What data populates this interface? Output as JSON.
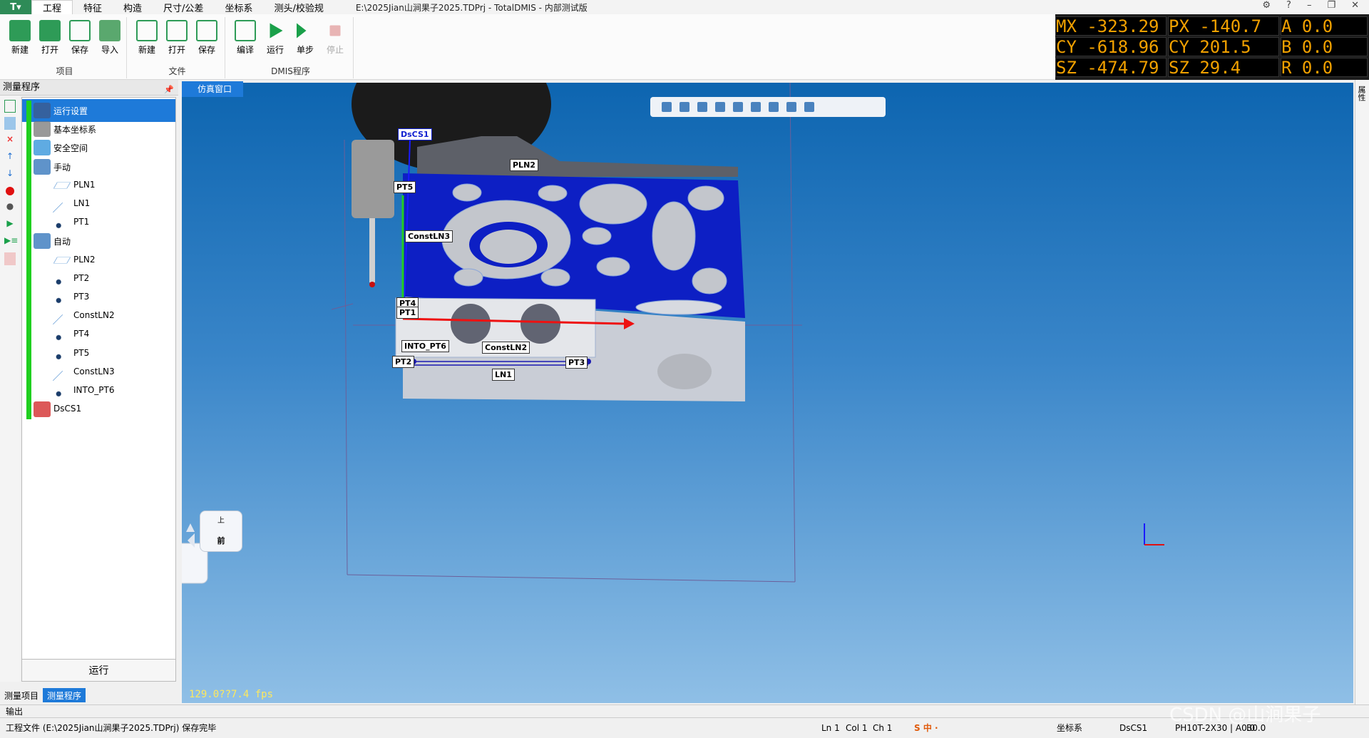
{
  "app": {
    "menu_label": "T▾",
    "window_title": "E:\\2025Jian山涧果子2025.TDPrj - TotalDMIS - 内部测试版"
  },
  "tabs": [
    "工程",
    "特征",
    "构造",
    "尺寸/公差",
    "坐标系",
    "测头/校验规"
  ],
  "ribbon": {
    "groups": [
      {
        "label": "项目",
        "buttons": [
          "新建",
          "打开",
          "保存",
          "导入"
        ]
      },
      {
        "label": "文件",
        "buttons": [
          "新建",
          "打开",
          "保存"
        ]
      },
      {
        "label": "DMIS程序",
        "buttons": [
          "编译",
          "运行",
          "单步",
          "停止"
        ]
      }
    ]
  },
  "readout": {
    "rows": [
      [
        "MX",
        "-323.29",
        "PX",
        "-140.7",
        "A",
        "0.0"
      ],
      [
        "CY",
        "-618.96",
        "CY",
        "201.5",
        "B",
        "0.0"
      ],
      [
        "SZ",
        "-474.79",
        "SZ",
        "29.4",
        "R",
        "0.0"
      ]
    ],
    "color": "#f2a100"
  },
  "right_sidebar": {
    "label": "属性"
  },
  "left_panel": {
    "title": "测量程序",
    "items": [
      {
        "label": "运行设置",
        "icon": "run-settings-icon",
        "level": 0,
        "selected": true
      },
      {
        "label": "基本坐标系",
        "icon": "base-csys-icon",
        "level": 0
      },
      {
        "label": "安全空间",
        "icon": "safe-space-icon",
        "level": 0
      },
      {
        "label": "手动",
        "icon": "folder-tree-icon",
        "level": 0
      },
      {
        "label": "PLN1",
        "icon": "plane-icon",
        "level": 1
      },
      {
        "label": "LN1",
        "icon": "line-icon",
        "level": 1
      },
      {
        "label": "PT1",
        "icon": "point-icon",
        "level": 1
      },
      {
        "label": "自动",
        "icon": "folder-tree-icon",
        "level": 0
      },
      {
        "label": "PLN2",
        "icon": "plane-icon",
        "level": 1
      },
      {
        "label": "PT2",
        "icon": "point-icon",
        "level": 1
      },
      {
        "label": "PT3",
        "icon": "point-icon",
        "level": 1
      },
      {
        "label": "ConstLN2",
        "icon": "line-icon",
        "level": 1
      },
      {
        "label": "PT4",
        "icon": "point-icon",
        "level": 1
      },
      {
        "label": "PT5",
        "icon": "point-icon",
        "level": 1
      },
      {
        "label": "ConstLN3",
        "icon": "line-icon",
        "level": 1
      },
      {
        "label": "INTO_PT6",
        "icon": "point-icon",
        "level": 1
      },
      {
        "label": "DsCS1",
        "icon": "csys-icon",
        "level": 0
      }
    ],
    "run_button": "运行",
    "bottom_tabs": [
      "测量项目",
      "测量程序"
    ]
  },
  "viewport": {
    "tab_label": "仿真窗口",
    "fps": "129.0??7.4 fps",
    "labels": [
      "DsCS1",
      "PLN2",
      "PT5",
      "ConstLN3",
      "PT4",
      "PT1",
      "INTO_PT6",
      "ConstLN2",
      "PT2",
      "PT3",
      "LN1"
    ],
    "cube_labels": {
      "top": "上",
      "front": "前"
    },
    "colors": {
      "plane": "#0d1fc4",
      "part": "#c9cdd6",
      "bg": "#3a86c9"
    }
  },
  "output_label": "输出",
  "status": {
    "message": "工程文件 (E:\\2025Jian山涧果子2025.TDPrj) 保存完毕",
    "ln": "Ln 1",
    "col": "Col 1",
    "ch": "Ch 1",
    "csys_label": "坐标系",
    "csys_value": "DsCS1",
    "probe": "PH10T-2X30 | A0.0",
    "b": "B0.0",
    "watermark": "CSDN @山涧果子"
  }
}
